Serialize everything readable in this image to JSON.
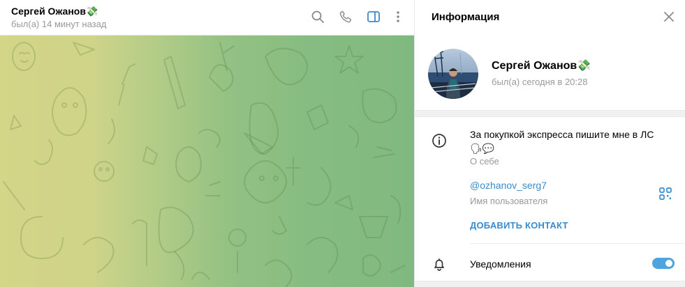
{
  "chat": {
    "header": {
      "name": "Сергей Ожанов💸",
      "status": "был(а) 14 минут назад"
    },
    "icons": [
      "search-icon",
      "phone-icon",
      "sidebar-toggle-icon",
      "more-vertical-icon"
    ],
    "background_colors": [
      "#d3d587",
      "#b2cc87",
      "#86bc81"
    ]
  },
  "info_panel": {
    "title": "Информация",
    "profile": {
      "name": "Сергей Ожанов💸",
      "status": "был(а) сегодня в 20:28"
    },
    "bio": {
      "text": "За покупкой экспресса пишите мне в ЛС🗣💬",
      "label": "О себе"
    },
    "username": {
      "value": "@ozhanov_serg7",
      "label": "Имя пользователя"
    },
    "add_contact_label": "ДОБАВИТЬ КОНТАКТ",
    "notifications": {
      "label": "Уведомления",
      "enabled": true
    },
    "accent_color": "#3a8bcc"
  }
}
